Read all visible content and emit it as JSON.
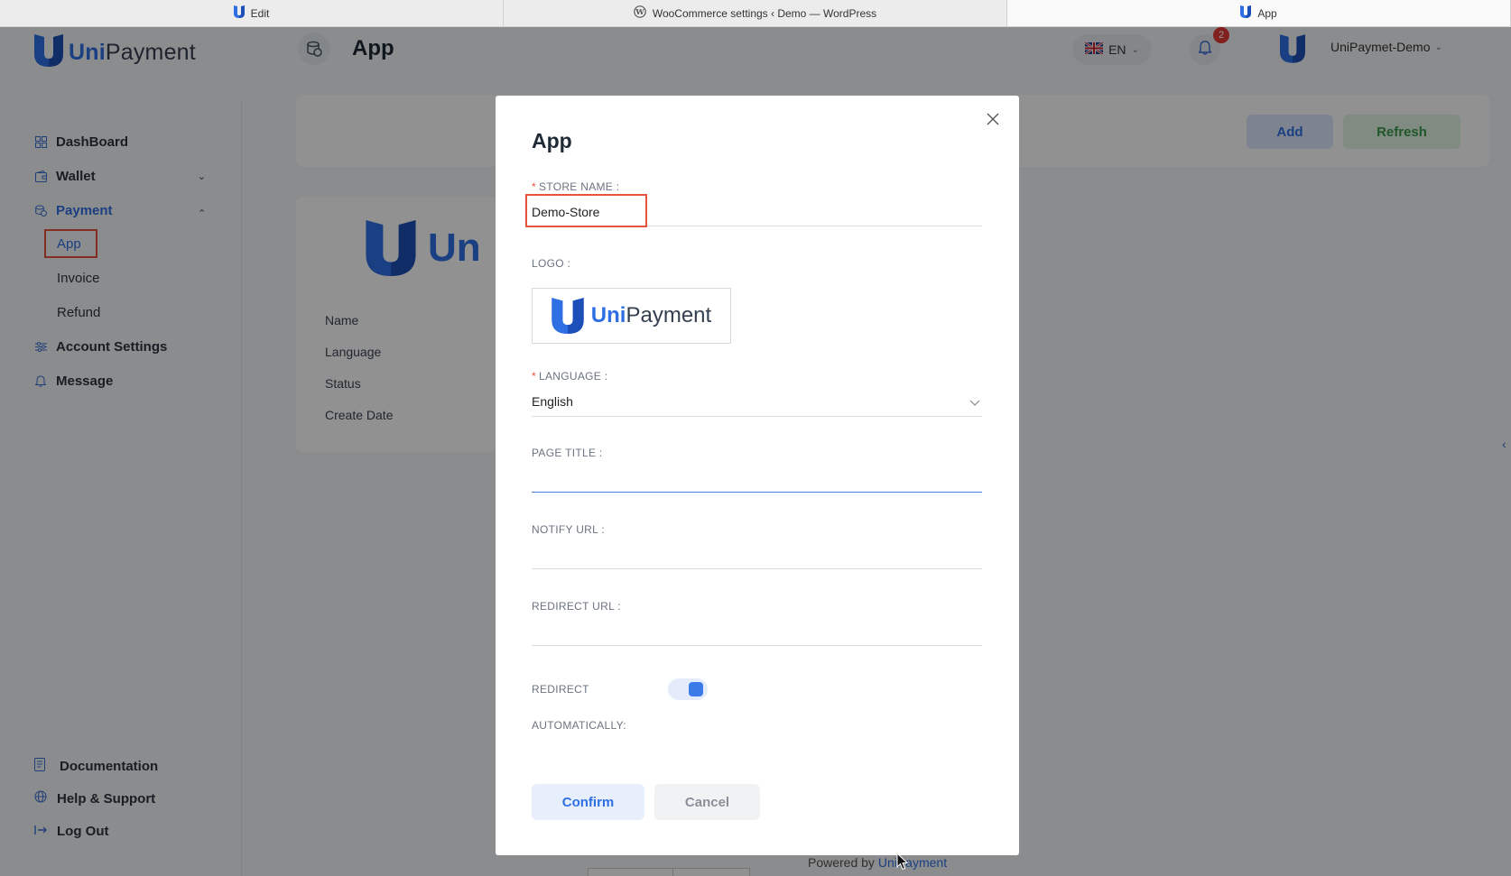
{
  "browser_tabs": [
    {
      "label": "Edit",
      "icon": "unipayment-icon"
    },
    {
      "label": "WooCommerce settings ‹ Demo — WordPress",
      "icon": "wordpress-icon"
    },
    {
      "label": "App",
      "icon": "unipayment-icon"
    }
  ],
  "header": {
    "brand_uni": "Uni",
    "brand_rest": "Payment",
    "page_title": "App",
    "language": "EN",
    "notification_count": "2",
    "account_name": "UniPaymet-Demo"
  },
  "sidebar": {
    "items": [
      {
        "label": "DashBoard",
        "icon": "grid-icon"
      },
      {
        "label": "Wallet",
        "icon": "wallet-icon"
      },
      {
        "label": "Payment",
        "icon": "payment-icon"
      },
      {
        "label": "Account Settings",
        "icon": "settings-icon"
      },
      {
        "label": "Message",
        "icon": "bell-icon"
      }
    ],
    "payment_sub": [
      {
        "label": "App"
      },
      {
        "label": "Invoice"
      },
      {
        "label": "Refund"
      }
    ],
    "footer": [
      {
        "label": "Documentation",
        "icon": "document-icon"
      },
      {
        "label": "Help & Support",
        "icon": "globe-icon"
      },
      {
        "label": "Log Out",
        "icon": "logout-icon"
      }
    ]
  },
  "main": {
    "add_label": "Add",
    "refresh_label": "Refresh",
    "detail_logo_text": "Un",
    "detail_labels": [
      "Name",
      "Language",
      "Status",
      "Create Date"
    ],
    "powered_prefix": "Powered by",
    "powered_link": "UniPayment"
  },
  "modal": {
    "title": "App",
    "store_name_label": "STORE NAME :",
    "store_name_value": "Demo-Store",
    "logo_label": "LOGO :",
    "logo_uni": "Uni",
    "logo_rest": "Payment",
    "language_label": "LANGUAGE :",
    "language_value": "English",
    "page_title_label": "PAGE TITLE :",
    "notify_url_label": "NOTIFY URL :",
    "redirect_url_label": "REDIRECT URL :",
    "redirect_label_line1": "REDIRECT",
    "redirect_label_line2": "AUTOMATICALLY:",
    "redirect_enabled": true,
    "confirm_label": "Confirm",
    "cancel_label": "Cancel"
  },
  "colors": {
    "accent": "#2f6fe4",
    "highlight": "#e5533d",
    "badge": "#e53935",
    "refresh": "#3b9a4a"
  }
}
